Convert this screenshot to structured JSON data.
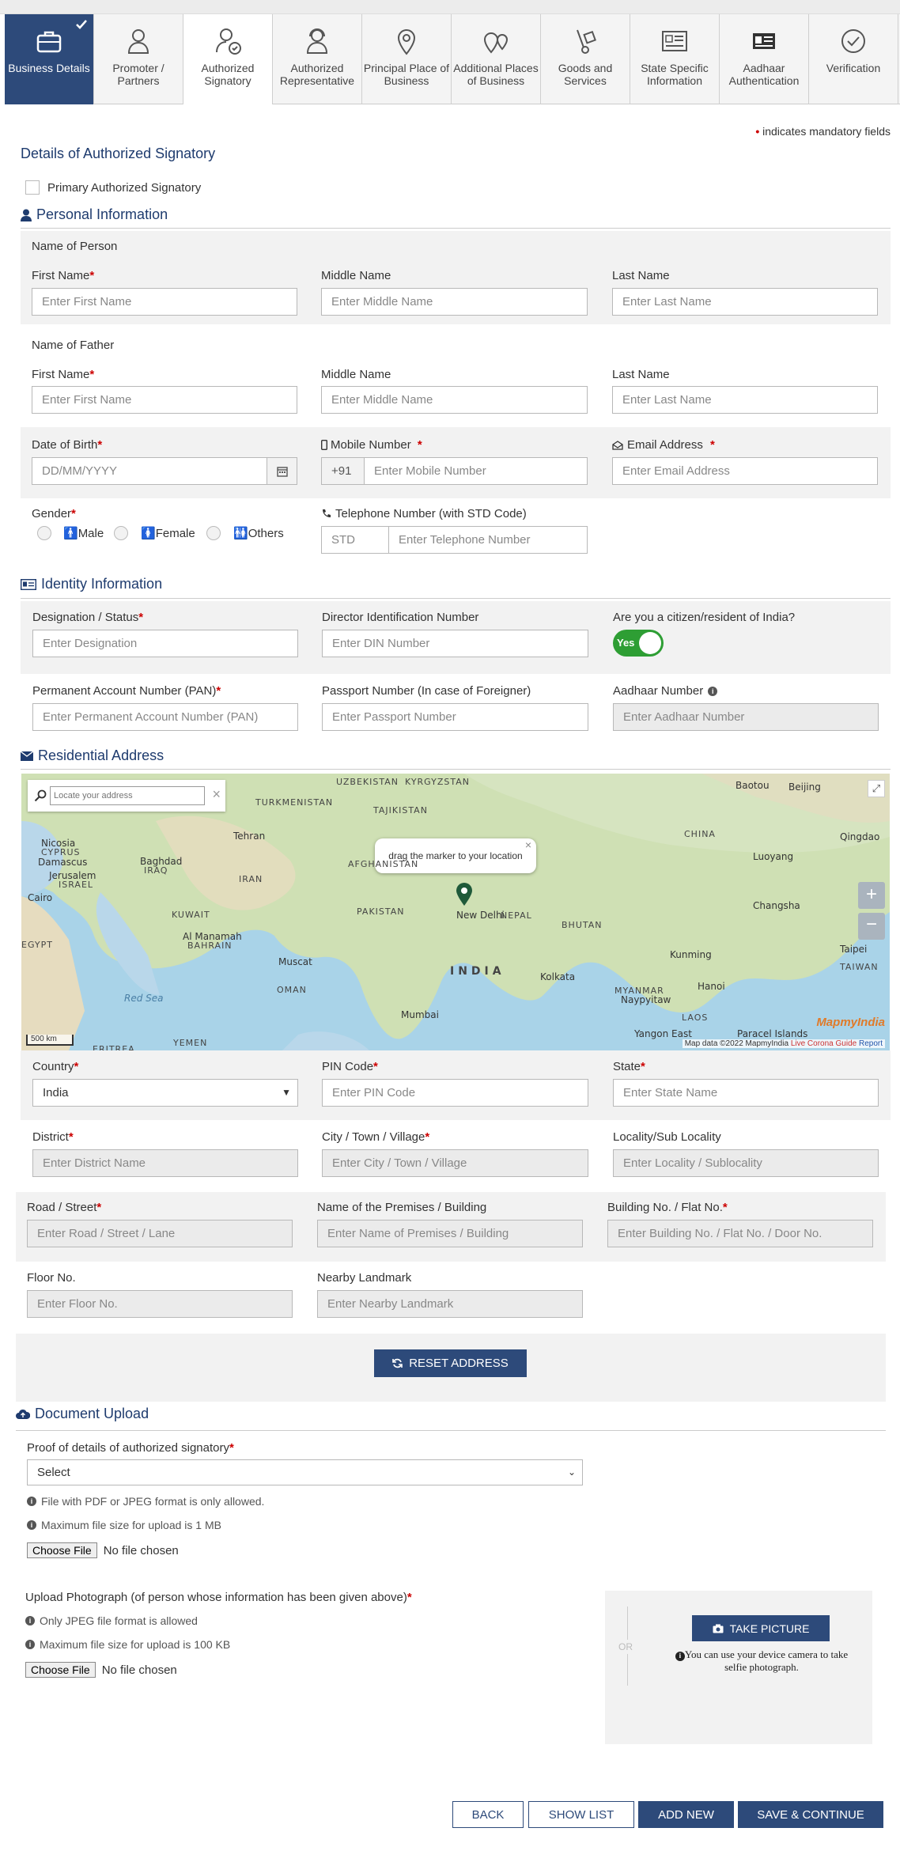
{
  "steps": [
    {
      "label": "Business Details",
      "icon": "briefcase-icon"
    },
    {
      "label": "Promoter / Partners",
      "icon": "user-icon"
    },
    {
      "label": "Authorized Signatory",
      "icon": "user-check-icon"
    },
    {
      "label": "Authorized Representative",
      "icon": "user-headset-icon"
    },
    {
      "label": "Principal Place of Business",
      "icon": "map-pin-icon"
    },
    {
      "label": "Additional Places of Business",
      "icon": "map-pins-icon"
    },
    {
      "label": "Goods and Services",
      "icon": "hand-truck-icon"
    },
    {
      "label": "State Specific Information",
      "icon": "id-card-icon"
    },
    {
      "label": "Aadhaar Authentication",
      "icon": "aadhaar-card-icon"
    },
    {
      "label": "Verification",
      "icon": "check-circle-icon"
    }
  ],
  "mandatory_note": "indicates mandatory fields",
  "page_title": "Details of Authorized Signatory",
  "primary_signatory": "Primary Authorized Signatory",
  "personal": {
    "heading": "Personal Information",
    "name_of_person": "Name of Person",
    "name_of_father": "Name of Father",
    "first_name": "First Name",
    "middle_name": "Middle Name",
    "last_name": "Last Name",
    "ph_first": "Enter First Name",
    "ph_middle": "Enter Middle Name",
    "ph_last": "Enter Last Name",
    "dob": "Date of Birth",
    "dob_ph": "DD/MM/YYYY",
    "mobile": "Mobile Number",
    "mobile_prefix": "+91",
    "mobile_ph": "Enter Mobile Number",
    "email": "Email Address",
    "email_ph": "Enter Email Address",
    "gender": "Gender",
    "male": "Male",
    "female": "Female",
    "others": "Others",
    "tel": "Telephone Number (with STD Code)",
    "std_ph": "STD",
    "tel_ph": "Enter Telephone Number"
  },
  "identity": {
    "heading": "Identity Information",
    "designation": "Designation / Status",
    "designation_ph": "Enter Designation",
    "din": "Director Identification Number",
    "din_ph": "Enter DIN Number",
    "citizen": "Are you a citizen/resident of India?",
    "citizen_value": "Yes",
    "pan": "Permanent Account Number (PAN)",
    "pan_ph": "Enter Permanent Account Number (PAN)",
    "passport": "Passport Number (In case of Foreigner)",
    "passport_ph": "Enter Passport Number",
    "aadhaar": "Aadhaar Number",
    "aadhaar_ph": "Enter Aadhaar Number"
  },
  "address": {
    "heading": "Residential Address",
    "map_search_ph": "Locate your address",
    "map_tooltip": "drag the marker to your location",
    "map_scale": "500 km",
    "map_attrib": "Map data ©2022 MapmyIndia",
    "map_corona": "Live Corona Guide",
    "map_report": "Report",
    "map_brand": "MapmyIndia",
    "map_places": [
      "UZBEKISTAN",
      "KYRGYZSTAN",
      "TURKMENISTAN",
      "TAJIKISTAN",
      "Tehran",
      "Nicosia",
      "CYPRUS",
      "Damascus",
      "Baghdad",
      "IRAQ",
      "Jerusalem",
      "ISRAEL",
      "Cairo",
      "IRAN",
      "AFGHANISTAN",
      "KUWAIT",
      "Al Manamah",
      "BAHRAIN",
      "PAKISTAN",
      "New Delhi",
      "NEPAL",
      "BHUTAN",
      "Kolkata",
      "INDIA",
      "Muscat",
      "OMAN",
      "Mumbai",
      "Red Sea",
      "YEMEN",
      "ERITREA",
      "EGYPT",
      "Baotou",
      "Beijing",
      "Qingdao",
      "CHINA",
      "Luoyang",
      "Changsha",
      "Kunming",
      "Taipei",
      "TAIWAN",
      "MYANMAR",
      "Naypyitaw",
      "Hanoi",
      "LAOS",
      "Yangon East",
      "Paracel Islands"
    ],
    "country": "Country",
    "country_value": "India",
    "pin": "PIN Code",
    "pin_ph": "Enter PIN Code",
    "state": "State",
    "state_ph": "Enter State Name",
    "district": "District",
    "district_ph": "Enter District Name",
    "city": "City / Town / Village",
    "city_ph": "Enter City / Town / Village",
    "locality": "Locality/Sub Locality",
    "locality_ph": "Enter Locality / Sublocality",
    "road": "Road / Street",
    "road_ph": "Enter Road / Street / Lane",
    "premises": "Name of the Premises / Building",
    "premises_ph": "Enter Name of Premises / Building",
    "building": "Building No. / Flat No.",
    "building_ph": "Enter Building No. / Flat No. / Door No.",
    "floor": "Floor No.",
    "floor_ph": "Enter Floor No.",
    "landmark": "Nearby Landmark",
    "landmark_ph": "Enter Nearby Landmark",
    "reset": "RESET ADDRESS"
  },
  "documents": {
    "heading": "Document Upload",
    "proof": "Proof of details of authorized signatory",
    "proof_select": "Select",
    "info1": "File with PDF or JPEG format is only allowed.",
    "info2": "Maximum file size for upload is 1 MB",
    "choose": "Choose File",
    "no_file": "No file chosen",
    "photo": "Upload Photograph (of person whose information has been given above)",
    "info3": "Only JPEG file format is allowed",
    "info4": "Maximum file size for upload is 100 KB",
    "or": "OR",
    "take_picture": "TAKE PICTURE",
    "camera_note": "You can use your device camera to take selfie photograph."
  },
  "footer": {
    "back": "BACK",
    "show_list": "SHOW LIST",
    "add_new": "ADD NEW",
    "save": "SAVE & CONTINUE"
  },
  "colors": {
    "primary": "#2d4a7a",
    "toggle": "#2e9e34",
    "required": "#cc0000"
  }
}
